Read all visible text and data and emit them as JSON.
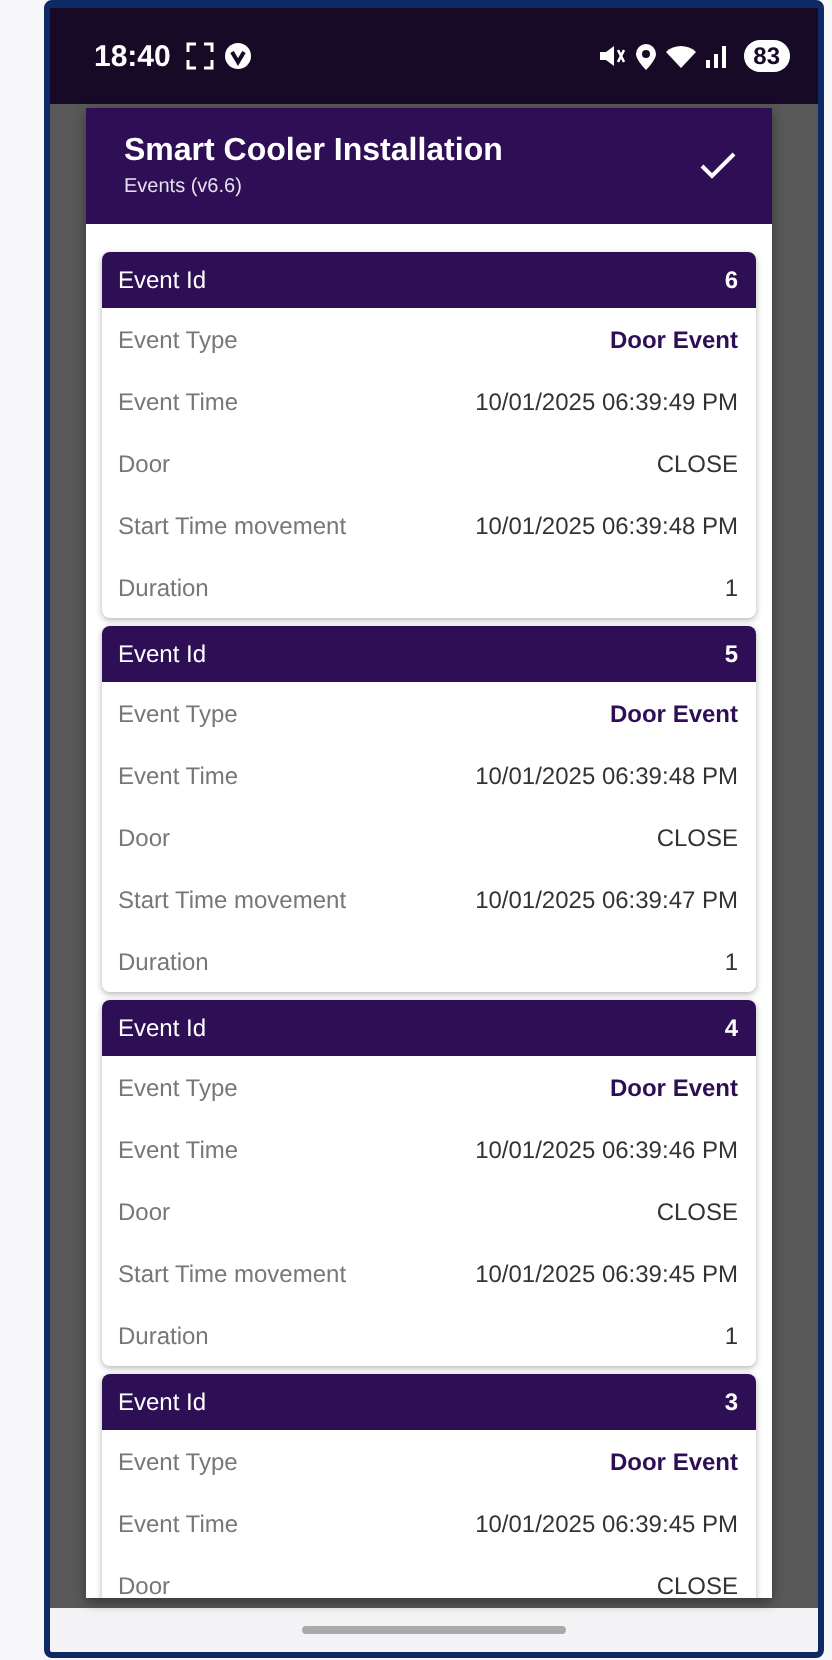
{
  "status_bar": {
    "time": "18:40",
    "battery": "83"
  },
  "dialog": {
    "title": "Smart Cooler Installation",
    "subtitle": "Events (v6.6)"
  },
  "events": [
    {
      "header": {
        "label": "Event Id",
        "value": "6"
      },
      "fields": [
        {
          "label": "Event Type",
          "value": "Door Event",
          "emphasis": true
        },
        {
          "label": "Event Time",
          "value": "10/01/2025 06:39:49 PM",
          "emphasis": false
        },
        {
          "label": "Door",
          "value": "CLOSE",
          "emphasis": false
        },
        {
          "label": "Start Time movement",
          "value": "10/01/2025 06:39:48 PM",
          "emphasis": false
        },
        {
          "label": "Duration",
          "value": "1",
          "emphasis": false
        }
      ]
    },
    {
      "header": {
        "label": "Event Id",
        "value": "5"
      },
      "fields": [
        {
          "label": "Event Type",
          "value": "Door Event",
          "emphasis": true
        },
        {
          "label": "Event Time",
          "value": "10/01/2025 06:39:48 PM",
          "emphasis": false
        },
        {
          "label": "Door",
          "value": "CLOSE",
          "emphasis": false
        },
        {
          "label": "Start Time movement",
          "value": "10/01/2025 06:39:47 PM",
          "emphasis": false
        },
        {
          "label": "Duration",
          "value": "1",
          "emphasis": false
        }
      ]
    },
    {
      "header": {
        "label": "Event Id",
        "value": "4"
      },
      "fields": [
        {
          "label": "Event Type",
          "value": "Door Event",
          "emphasis": true
        },
        {
          "label": "Event Time",
          "value": "10/01/2025 06:39:46 PM",
          "emphasis": false
        },
        {
          "label": "Door",
          "value": "CLOSE",
          "emphasis": false
        },
        {
          "label": "Start Time movement",
          "value": "10/01/2025 06:39:45 PM",
          "emphasis": false
        },
        {
          "label": "Duration",
          "value": "1",
          "emphasis": false
        }
      ]
    },
    {
      "header": {
        "label": "Event Id",
        "value": "3"
      },
      "fields": [
        {
          "label": "Event Type",
          "value": "Door Event",
          "emphasis": true
        },
        {
          "label": "Event Time",
          "value": "10/01/2025 06:39:45 PM",
          "emphasis": false
        },
        {
          "label": "Door",
          "value": "CLOSE",
          "emphasis": false
        }
      ]
    }
  ]
}
